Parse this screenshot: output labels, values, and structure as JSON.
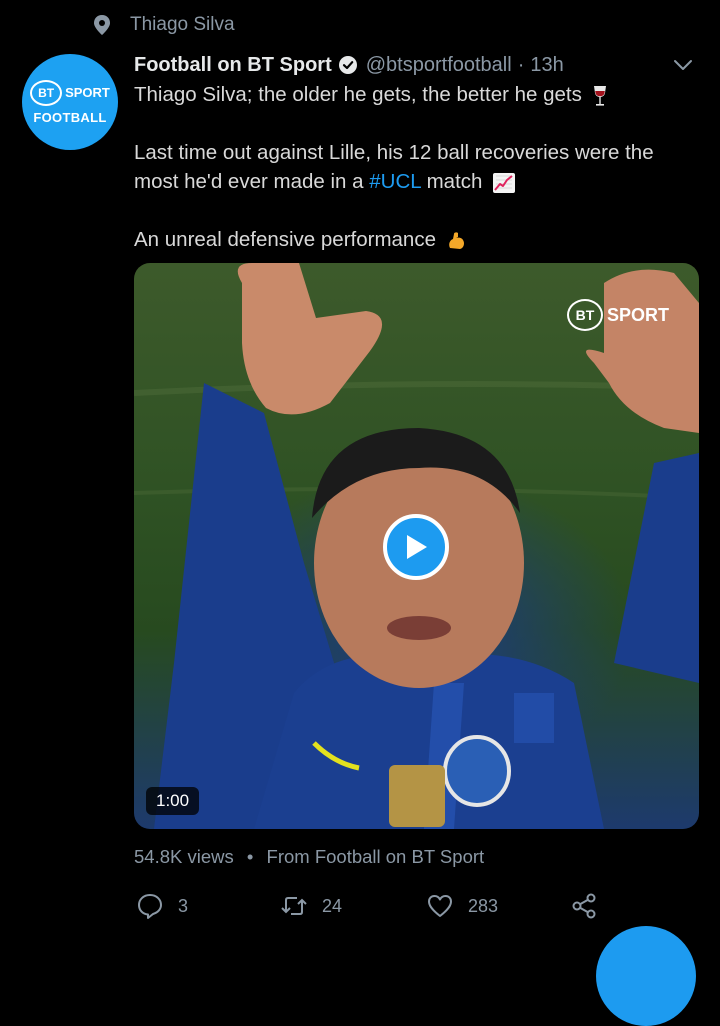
{
  "context": {
    "icon": "location-pin-icon",
    "text": "Thiago Silva"
  },
  "tweet": {
    "avatar": {
      "line1_badge": "BT",
      "line1_text": "SPORT",
      "line2": "FOOTBALL"
    },
    "author_name": "Football on BT Sport",
    "handle": "@btsportfootball",
    "separator": "·",
    "time": "13h",
    "lines": {
      "l1": "Thiago Silva; the older he gets, the better he gets",
      "l2": "Last time out against Lille, his 12 ball recoveries were the",
      "l3_pre": "most he'd ever made in a ",
      "l3_hashtag": "#UCL",
      "l3_post": " match",
      "l4": "An unreal defensive performance"
    },
    "media": {
      "watermark_badge": "BT",
      "watermark_text": "SPORT",
      "duration": "1:00"
    },
    "meta": {
      "views": "54.8K views",
      "bullet": "•",
      "source": "From Football on BT Sport"
    },
    "actions": {
      "replies": "3",
      "retweets": "24",
      "likes": "283"
    }
  },
  "colors": {
    "accent": "#1d9bf0",
    "muted": "#8b98a5",
    "background": "#000000"
  }
}
